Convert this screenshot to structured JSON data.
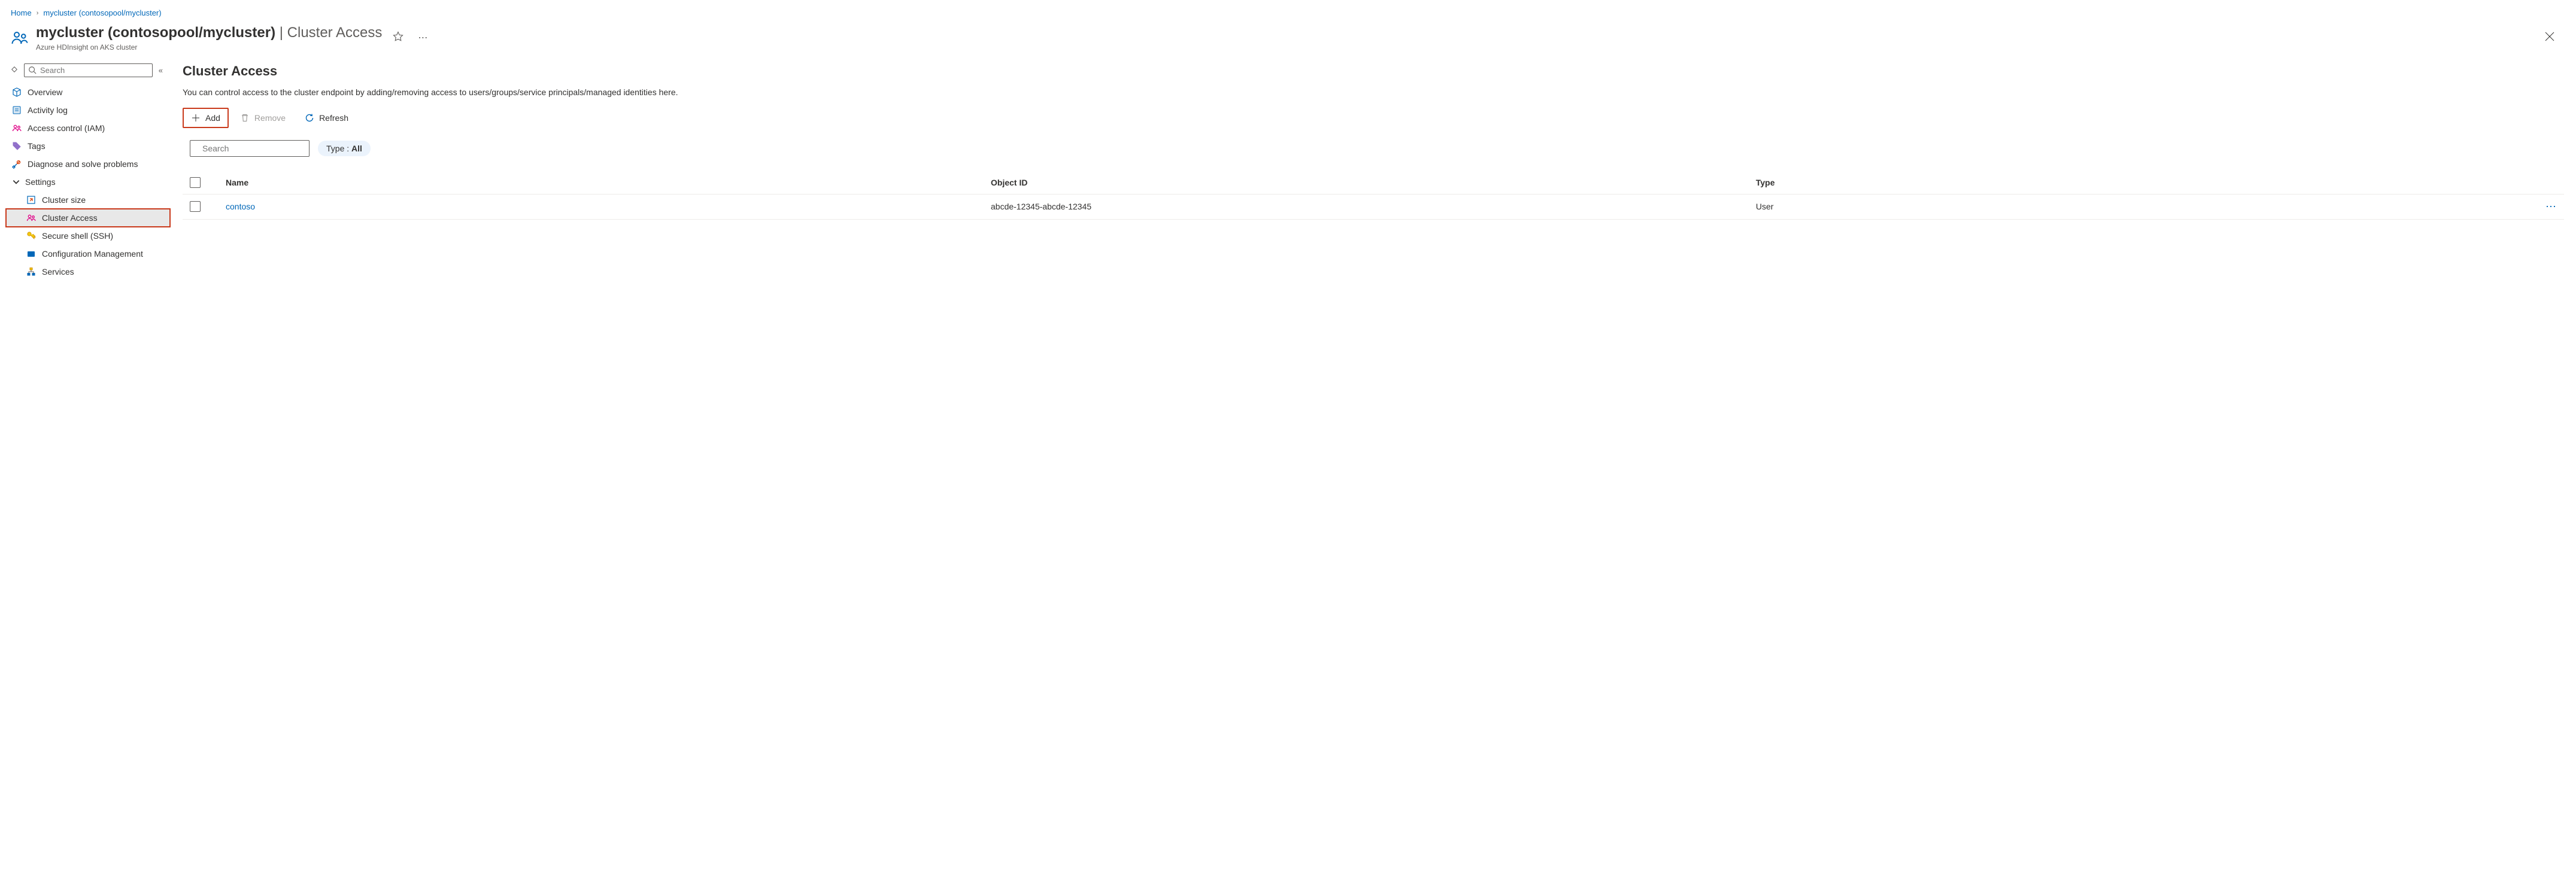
{
  "breadcrumb": {
    "home": "Home",
    "current": "mycluster (contosopool/mycluster)"
  },
  "header": {
    "title_main": "mycluster (contosopool/mycluster)",
    "title_sub": "Cluster Access",
    "subtitle": "Azure HDInsight on AKS cluster"
  },
  "sidebar": {
    "search_placeholder": "Search",
    "items": [
      {
        "label": "Overview"
      },
      {
        "label": "Activity log"
      },
      {
        "label": "Access control (IAM)"
      },
      {
        "label": "Tags"
      },
      {
        "label": "Diagnose and solve problems"
      }
    ],
    "settings_label": "Settings",
    "settings_children": [
      {
        "label": "Cluster size"
      },
      {
        "label": "Cluster Access"
      },
      {
        "label": "Secure shell (SSH)"
      },
      {
        "label": "Configuration Management"
      },
      {
        "label": "Services"
      }
    ]
  },
  "main": {
    "heading": "Cluster Access",
    "description": "You can control access to the cluster endpoint by adding/removing access to users/groups/service principals/managed identities here.",
    "toolbar": {
      "add": "Add",
      "remove": "Remove",
      "refresh": "Refresh"
    },
    "filter": {
      "search_placeholder": "Search",
      "type_label": "Type : ",
      "type_value": "All"
    },
    "table": {
      "columns": {
        "name": "Name",
        "object_id": "Object ID",
        "type": "Type"
      },
      "rows": [
        {
          "name": "contoso",
          "object_id": "abcde-12345-abcde-12345",
          "type": "User"
        }
      ]
    }
  }
}
